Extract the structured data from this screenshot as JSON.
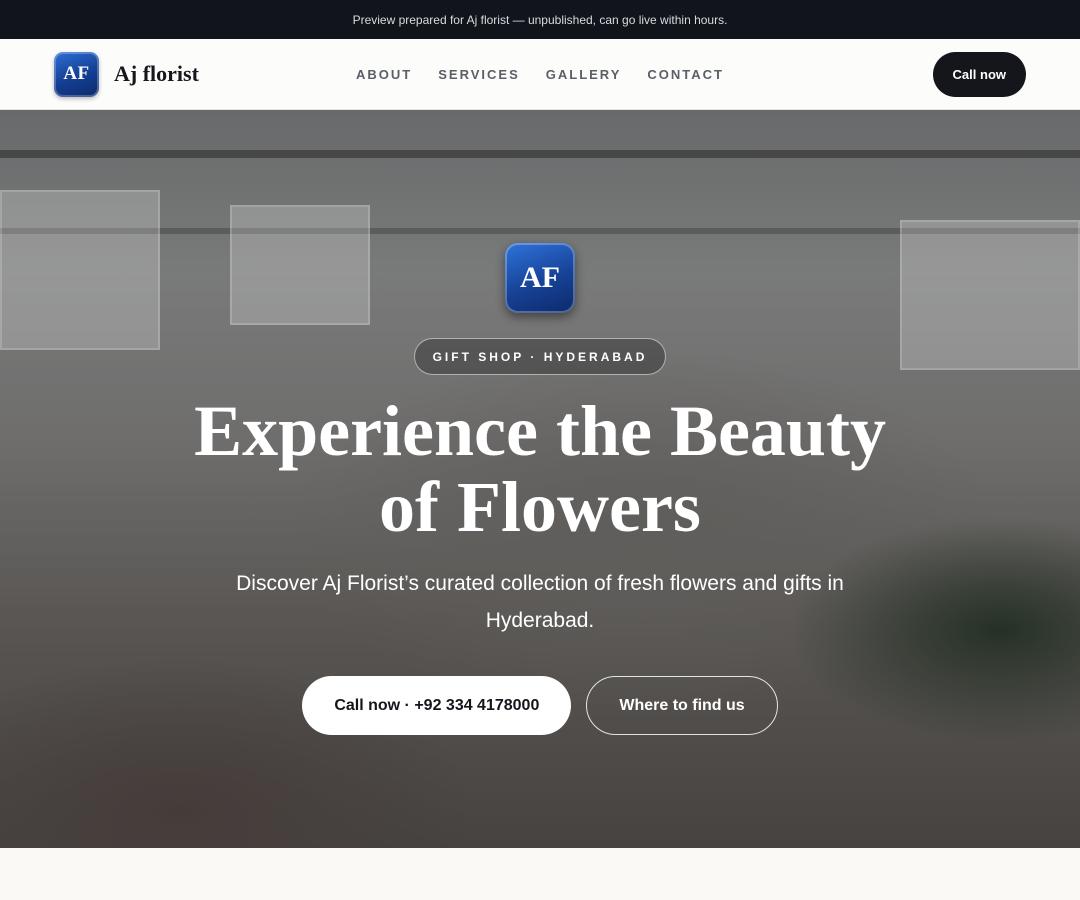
{
  "topbar": {
    "text": "Preview prepared for Aj florist — unpublished, can go live within hours."
  },
  "nav": {
    "logo_initials": "AF",
    "brand_name": "Aj florist",
    "items": [
      {
        "label": "ABOUT"
      },
      {
        "label": "SERVICES"
      },
      {
        "label": "GALLERY"
      },
      {
        "label": "CONTACT"
      }
    ],
    "cta": "Call now"
  },
  "hero": {
    "logo_initials": "AF",
    "tag": "GIFT SHOP · HYDERABAD",
    "headline": "Experience the Beauty of Flowers",
    "subtitle": "Discover Aj Florist’s curated collection of fresh flowers and gifts in Hyderabad.",
    "primary_cta": "Call now · +92 334 4178000",
    "secondary_cta": "Where to find us"
  }
}
